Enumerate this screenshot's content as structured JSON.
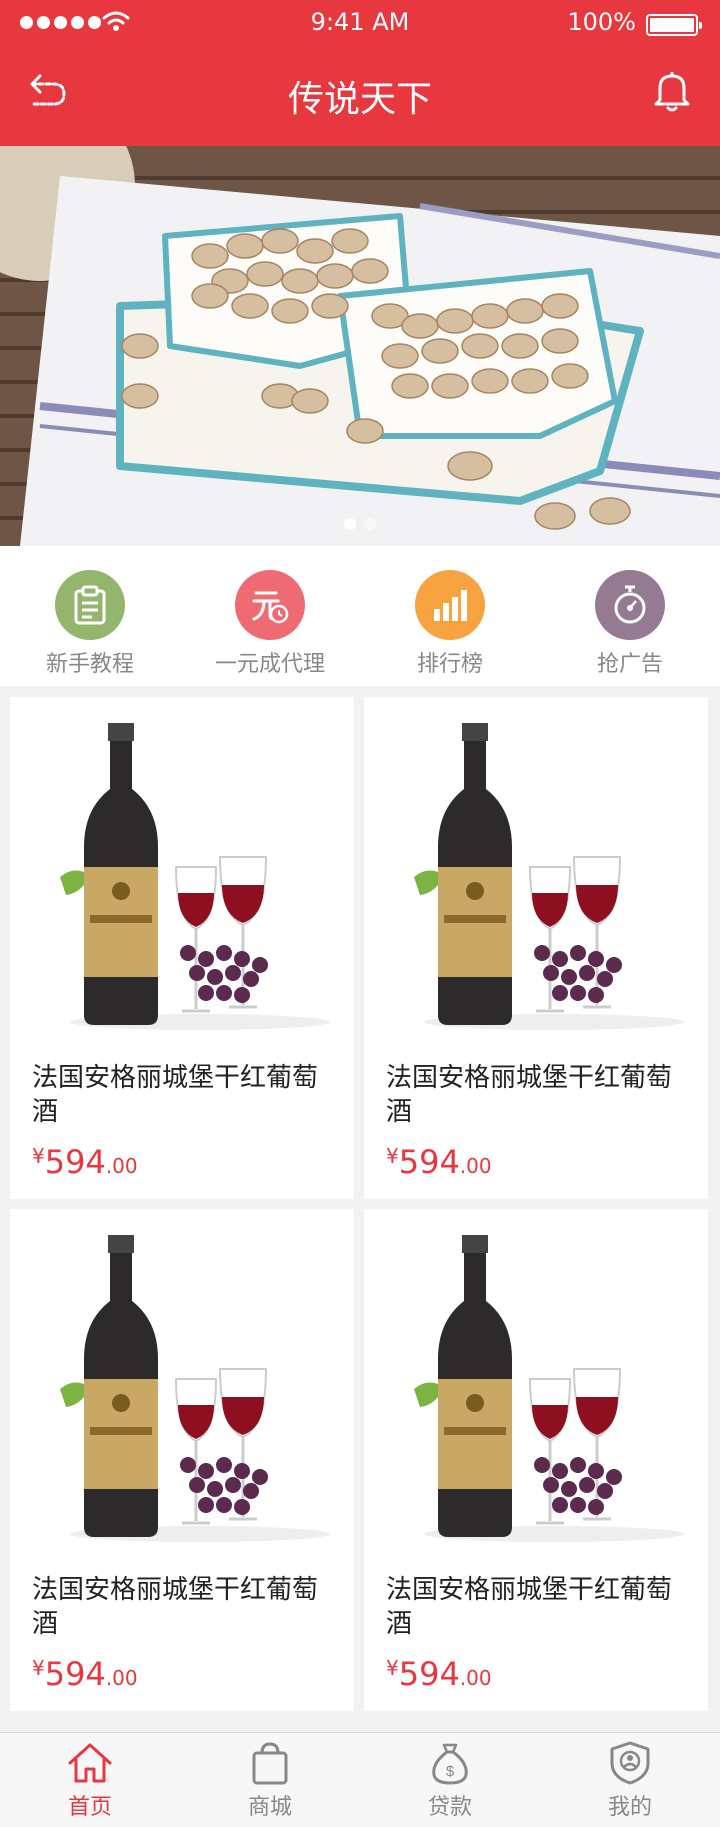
{
  "status_bar": {
    "time": "9:41 AM",
    "battery": "100%"
  },
  "header": {
    "title": "传说天下"
  },
  "banner": {
    "page_count": 2,
    "active_index": 0
  },
  "quick_menu": [
    {
      "label": "新手教程",
      "icon": "clipboard-icon",
      "color": "#94b56c"
    },
    {
      "label": "一元成代理",
      "icon": "yuan-clock-icon",
      "color": "#ef6b73"
    },
    {
      "label": "排行榜",
      "icon": "bar-chart-icon",
      "color": "#f7a440"
    },
    {
      "label": "抢广告",
      "icon": "stopwatch-icon",
      "color": "#957a93"
    }
  ],
  "products": [
    {
      "name": "法国安格丽城堡干红葡萄酒",
      "currency": "¥",
      "price_int": "594",
      "price_dec": ".00"
    },
    {
      "name": "法国安格丽城堡干红葡萄酒",
      "currency": "¥",
      "price_int": "594",
      "price_dec": ".00"
    },
    {
      "name": "法国安格丽城堡干红葡萄酒",
      "currency": "¥",
      "price_int": "594",
      "price_dec": ".00"
    },
    {
      "name": "法国安格丽城堡干红葡萄酒",
      "currency": "¥",
      "price_int": "594",
      "price_dec": ".00"
    }
  ],
  "tabbar": [
    {
      "label": "首页",
      "icon": "home-icon",
      "active": true
    },
    {
      "label": "商城",
      "icon": "shopping-bag-icon",
      "active": false
    },
    {
      "label": "贷款",
      "icon": "money-bag-icon",
      "active": false
    },
    {
      "label": "我的",
      "icon": "user-shield-icon",
      "active": false
    }
  ],
  "colors": {
    "brand": "#e8383f",
    "price": "#e8383f",
    "tab_inactive": "#888888"
  }
}
